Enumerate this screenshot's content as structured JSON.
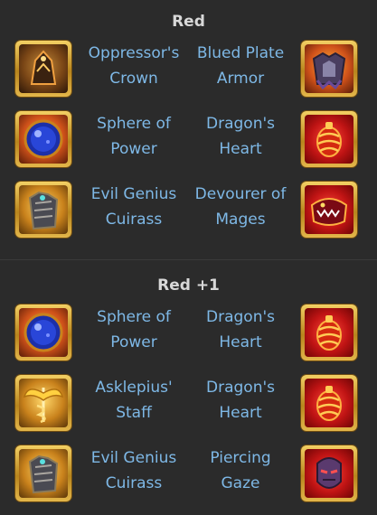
{
  "sections": [
    {
      "title": "Red",
      "rows": [
        {
          "left": {
            "line1": "Oppressor's",
            "line2": "Crown",
            "icon": "oppressors-crown-icon"
          },
          "right": {
            "line1": "Blued Plate",
            "line2": "Armor",
            "icon": "blued-plate-armor-icon"
          }
        },
        {
          "left": {
            "line1": "Sphere of",
            "line2": "Power",
            "icon": "sphere-of-power-icon"
          },
          "right": {
            "line1": "Dragon's",
            "line2": "Heart",
            "icon": "dragons-heart-icon"
          }
        },
        {
          "left": {
            "line1": "Evil Genius",
            "line2": "Cuirass",
            "icon": "evil-genius-cuirass-icon"
          },
          "right": {
            "line1": "Devourer of",
            "line2": "Mages",
            "icon": "devourer-of-mages-icon"
          }
        }
      ]
    },
    {
      "title": "Red +1",
      "rows": [
        {
          "left": {
            "line1": "Sphere of",
            "line2": "Power",
            "icon": "sphere-of-power-icon"
          },
          "right": {
            "line1": "Dragon's",
            "line2": "Heart",
            "icon": "dragons-heart-icon"
          }
        },
        {
          "left": {
            "line1": "Asklepius'",
            "line2": "Staff",
            "icon": "asklepius-staff-icon"
          },
          "right": {
            "line1": "Dragon's",
            "line2": "Heart",
            "icon": "dragons-heart-icon"
          }
        },
        {
          "left": {
            "line1": "Evil Genius",
            "line2": "Cuirass",
            "icon": "evil-genius-cuirass-icon"
          },
          "right": {
            "line1": "Piercing",
            "line2": "Gaze",
            "icon": "piercing-gaze-icon"
          }
        }
      ]
    }
  ],
  "colors": {
    "background": "#2b2b2b",
    "title": "#d8d8d8",
    "item_name": "#7eb8e6",
    "frame_gold": "#e3b64a"
  }
}
